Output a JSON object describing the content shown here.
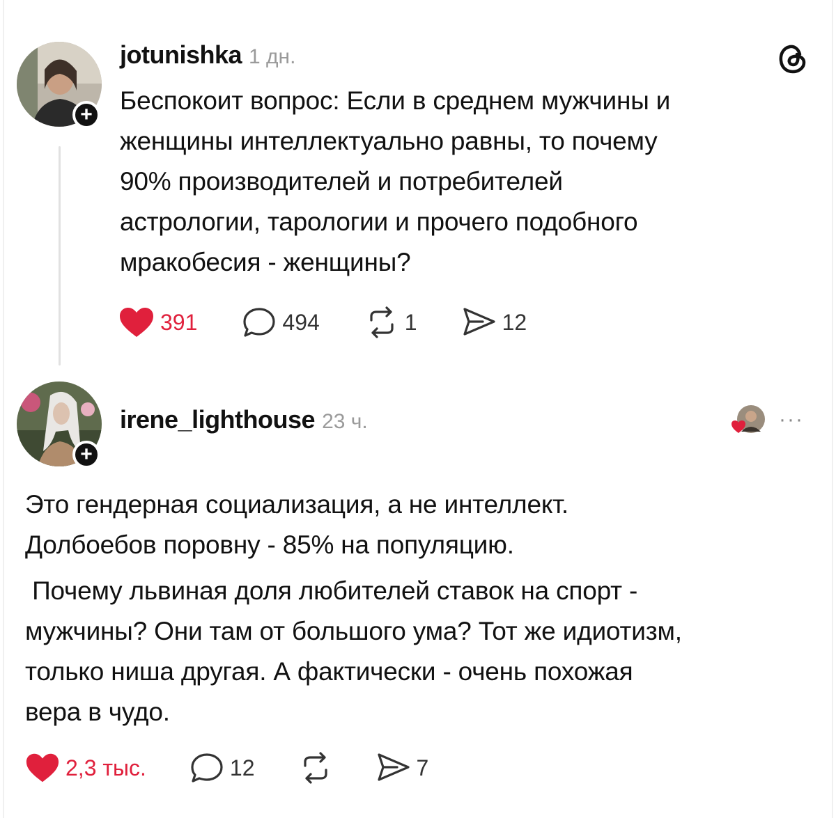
{
  "post1": {
    "username": "jotunishka",
    "time": "1 дн.",
    "text": "Беспокоит вопрос: Если в среднем мужчины и женщины интеллектуально равны, то почему 90% производителей и потребителей астрологии, тарологии и прочего подобного мракобесия - женщины?",
    "lines": [
      "Беспокоит вопрос: Если в среднем мужчины и",
      "женщины интеллектуально равны, то почему",
      "90% производителей и потребителей",
      "астрологии, тарологии и прочего подобного",
      "мракобесия - женщины?"
    ],
    "likes": "391",
    "comments": "494",
    "reposts": "1",
    "shares": "12"
  },
  "post2": {
    "username": "irene_lighthouse",
    "time": "23 ч.",
    "more": "···",
    "lines": [
      "Это гендерная социализация, а не интеллект.",
      "Долбоебов поровну - 85% на популяцию."
    ],
    "lines2": [
      " Почему львиная доля любителей ставок на спорт -",
      "мужчины? Они там от большого ума? Тот же идиотизм,",
      "только ниша другая. А фактически - очень похожая",
      "вера в чудо."
    ],
    "likes": "2,3 тыс.",
    "comments": "12",
    "shares": "7"
  },
  "icons": {
    "heart": "heart-icon",
    "comment": "comment-icon",
    "repost": "repost-icon",
    "share": "share-icon",
    "threads": "threads-logo-icon",
    "plus": "plus-icon"
  },
  "colors": {
    "like": "#e0203c",
    "text": "#111111",
    "muted": "#9a9a9a"
  }
}
